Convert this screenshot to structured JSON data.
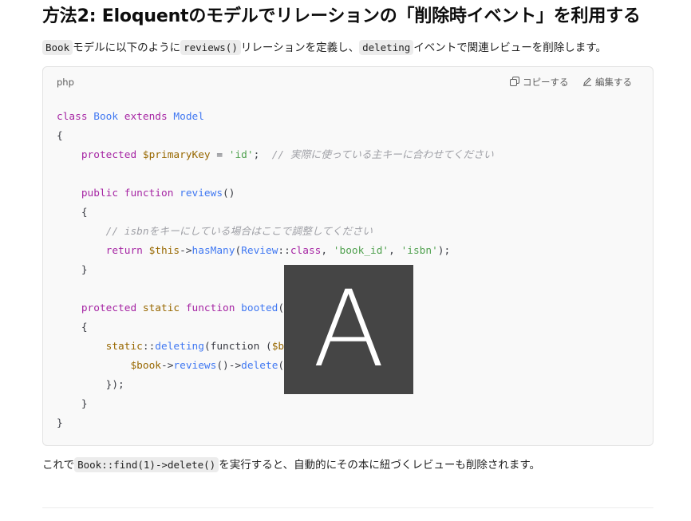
{
  "heading": "方法2: Eloquentのモデルでリレーションの「削除時イベント」を利用する",
  "intro": {
    "code1": "Book",
    "text1": "モデルに以下のように",
    "code2": "reviews()",
    "text2": "リレーションを定義し、",
    "code3": "deleting",
    "text3": "イベントで関連レビューを削除します。"
  },
  "code_block": {
    "language": "php",
    "copy_label": "コピーする",
    "edit_label": "編集する",
    "lines": [
      [
        [
          "kw",
          "class "
        ],
        [
          "cls",
          "Book "
        ],
        [
          "kw",
          "extends "
        ],
        [
          "cls",
          "Model"
        ]
      ],
      [
        [
          "pl",
          "{"
        ]
      ],
      [
        [
          "pl",
          "    "
        ],
        [
          "kw",
          "protected "
        ],
        [
          "var",
          "$primaryKey"
        ],
        [
          "pl",
          " = "
        ],
        [
          "str",
          "'id'"
        ],
        [
          "pl",
          ";  "
        ],
        [
          "cmt",
          "// 実際に使っている主キーに合わせてください"
        ]
      ],
      [],
      [
        [
          "pl",
          "    "
        ],
        [
          "kw",
          "public "
        ],
        [
          "kw",
          "function "
        ],
        [
          "fn",
          "reviews"
        ],
        [
          "pl",
          "()"
        ]
      ],
      [
        [
          "pl",
          "    {"
        ]
      ],
      [
        [
          "pl",
          "        "
        ],
        [
          "cmt",
          "// isbnをキーにしている場合はここで調整してください"
        ]
      ],
      [
        [
          "pl",
          "        "
        ],
        [
          "kw",
          "return "
        ],
        [
          "var",
          "$this"
        ],
        [
          "pl",
          "->"
        ],
        [
          "fn",
          "hasMany"
        ],
        [
          "pl",
          "("
        ],
        [
          "cls",
          "Review"
        ],
        [
          "pl",
          "::"
        ],
        [
          "kw",
          "class"
        ],
        [
          "pl",
          ", "
        ],
        [
          "str",
          "'book_id'"
        ],
        [
          "pl",
          ", "
        ],
        [
          "str",
          "'isbn'"
        ],
        [
          "pl",
          ");"
        ]
      ],
      [
        [
          "pl",
          "    }"
        ]
      ],
      [],
      [
        [
          "pl",
          "    "
        ],
        [
          "kw",
          "protected "
        ],
        [
          "var",
          "static "
        ],
        [
          "kw",
          "function "
        ],
        [
          "fn",
          "booted"
        ],
        [
          "pl",
          "()"
        ]
      ],
      [
        [
          "pl",
          "    {"
        ]
      ],
      [
        [
          "pl",
          "        "
        ],
        [
          "var",
          "static"
        ],
        [
          "pl",
          "::"
        ],
        [
          "fn",
          "deleting"
        ],
        [
          "pl",
          "(function ("
        ],
        [
          "var",
          "$book"
        ],
        [
          "pl",
          ") {"
        ]
      ],
      [
        [
          "pl",
          "            "
        ],
        [
          "var",
          "$book"
        ],
        [
          "pl",
          "->"
        ],
        [
          "fn",
          "reviews"
        ],
        [
          "pl",
          "()->"
        ],
        [
          "fn",
          "delete"
        ],
        [
          "pl",
          "();"
        ]
      ],
      [
        [
          "pl",
          "        });"
        ]
      ],
      [
        [
          "pl",
          "    }"
        ]
      ],
      [
        [
          "pl",
          "}"
        ]
      ]
    ]
  },
  "outro": {
    "text1": "これで",
    "code1": "Book::find(1)->delete()",
    "text2": "を実行すると、自動的にその本に紐づくレビューも削除されます。"
  },
  "overlay_letter": "A"
}
